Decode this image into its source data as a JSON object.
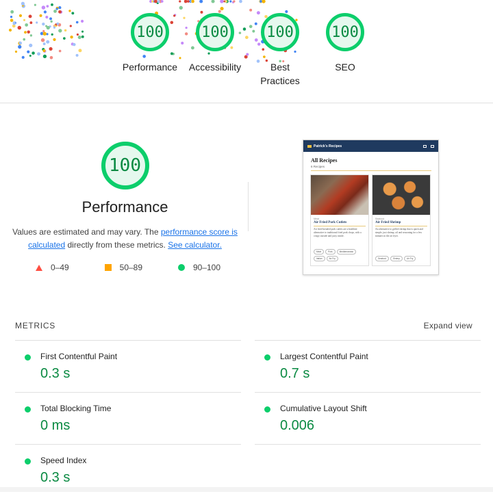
{
  "top_gauges": [
    {
      "score": "100",
      "label": "Performance"
    },
    {
      "score": "100",
      "label": "Accessibility"
    },
    {
      "score": "100",
      "label": "Best Practices"
    },
    {
      "score": "100",
      "label": "SEO"
    }
  ],
  "performance": {
    "score": "100",
    "title": "Performance",
    "desc_1": "Values are estimated and may vary. The ",
    "link_score": "performance score is calculated",
    "desc_2": " directly from these metrics. ",
    "link_calc": "See calculator."
  },
  "legend": [
    {
      "range": "0–49",
      "color": "#ff4e42"
    },
    {
      "range": "50–89",
      "color": "#ffa400"
    },
    {
      "range": "90–100",
      "color": "#0cce6b"
    }
  ],
  "thumbnail": {
    "brand": "Patrick's Recipes",
    "heading": "All Recipes",
    "count": "6 Recipes",
    "cards": [
      {
        "category": "Meat",
        "title": "Air Fried Pork Cutlets",
        "text": "Air fried breaded pork cutlets are a healthier alternative to traditional fried pork chops, with a crispy outside and juicy inside.",
        "tags": [
          "Meat",
          "Pork",
          "Mediterranean",
          "Italian",
          "Air Fry"
        ]
      },
      {
        "category": "Seafood",
        "title": "Air Fried Shrimp",
        "text": "An alternative to grilled shrimp that is quick and simple, just shrimp, oil and seasoning for a few minutes in the air fryer.",
        "tags": [
          "Seafood",
          "Shrimp",
          "Air Fry"
        ]
      }
    ]
  },
  "metrics": {
    "heading": "METRICS",
    "expand": "Expand view",
    "left": [
      {
        "name": "First Contentful Paint",
        "value": "0.3 s"
      },
      {
        "name": "Total Blocking Time",
        "value": "0 ms"
      },
      {
        "name": "Speed Index",
        "value": "0.3 s"
      }
    ],
    "right": [
      {
        "name": "Largest Contentful Paint",
        "value": "0.7 s"
      },
      {
        "name": "Cumulative Layout Shift",
        "value": "0.006"
      }
    ]
  },
  "colors": {
    "pass": "#0cce6b",
    "pass_text": "#0a8a42",
    "link": "#1a73e8"
  }
}
